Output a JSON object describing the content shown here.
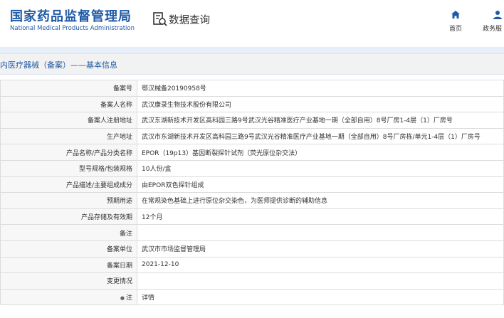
{
  "header": {
    "logo_cn": "国家药品监督管理局",
    "logo_en": "National Medical Products Administration",
    "search_title": "数据查询",
    "nav": [
      {
        "label": "首页",
        "icon": "home-icon"
      },
      {
        "label": "政务服",
        "icon": "user-icon"
      }
    ]
  },
  "section": {
    "title": "内医疗器械（备案）——基本信息"
  },
  "rows": [
    {
      "key": "备案号",
      "value": "鄂汉械备20190958号"
    },
    {
      "key": "备案人名称",
      "value": "武汉康录生物技术股份有限公司"
    },
    {
      "key": "备案人注册地址",
      "value": "武汉东湖新技术开发区高科园三路9号武汉光谷精准医疗产业基地一期（全部自用）8号厂房1-4层（1）厂房号"
    },
    {
      "key": "生产地址",
      "value": "武汉市东湖新技术开发区高科园三路9号武汉光谷精准医疗产业基地一期（全部自用）8号厂房栋/单元1-4层（1）厂房号"
    },
    {
      "key": "产品名称/产品分类名称",
      "value": "EPOR（19p13）基因断裂探针试剂（荧光原位杂交法）"
    },
    {
      "key": "型号规格/包装规格",
      "value": "10人份/盒"
    },
    {
      "key": "产品描述/主要组成成分",
      "value": "由EPOR双色探针组成"
    },
    {
      "key": "预期用途",
      "value": "在常规染色基础上进行原位杂交染色，为医师提供诊断的辅助信息"
    },
    {
      "key": "产品存储及有效期",
      "value": "12个月"
    },
    {
      "key": "备注",
      "value": ""
    },
    {
      "key": "备案单位",
      "value": "武汉市市场监督管理局"
    },
    {
      "key": "备案日期",
      "value": "2021-12-10"
    },
    {
      "key": "变更情况",
      "value": ""
    },
    {
      "key": "注",
      "value": "详情",
      "is_link": true
    }
  ],
  "colors": {
    "brand_blue": "#1f5aa6",
    "link_blue": "#1f5aa6"
  }
}
